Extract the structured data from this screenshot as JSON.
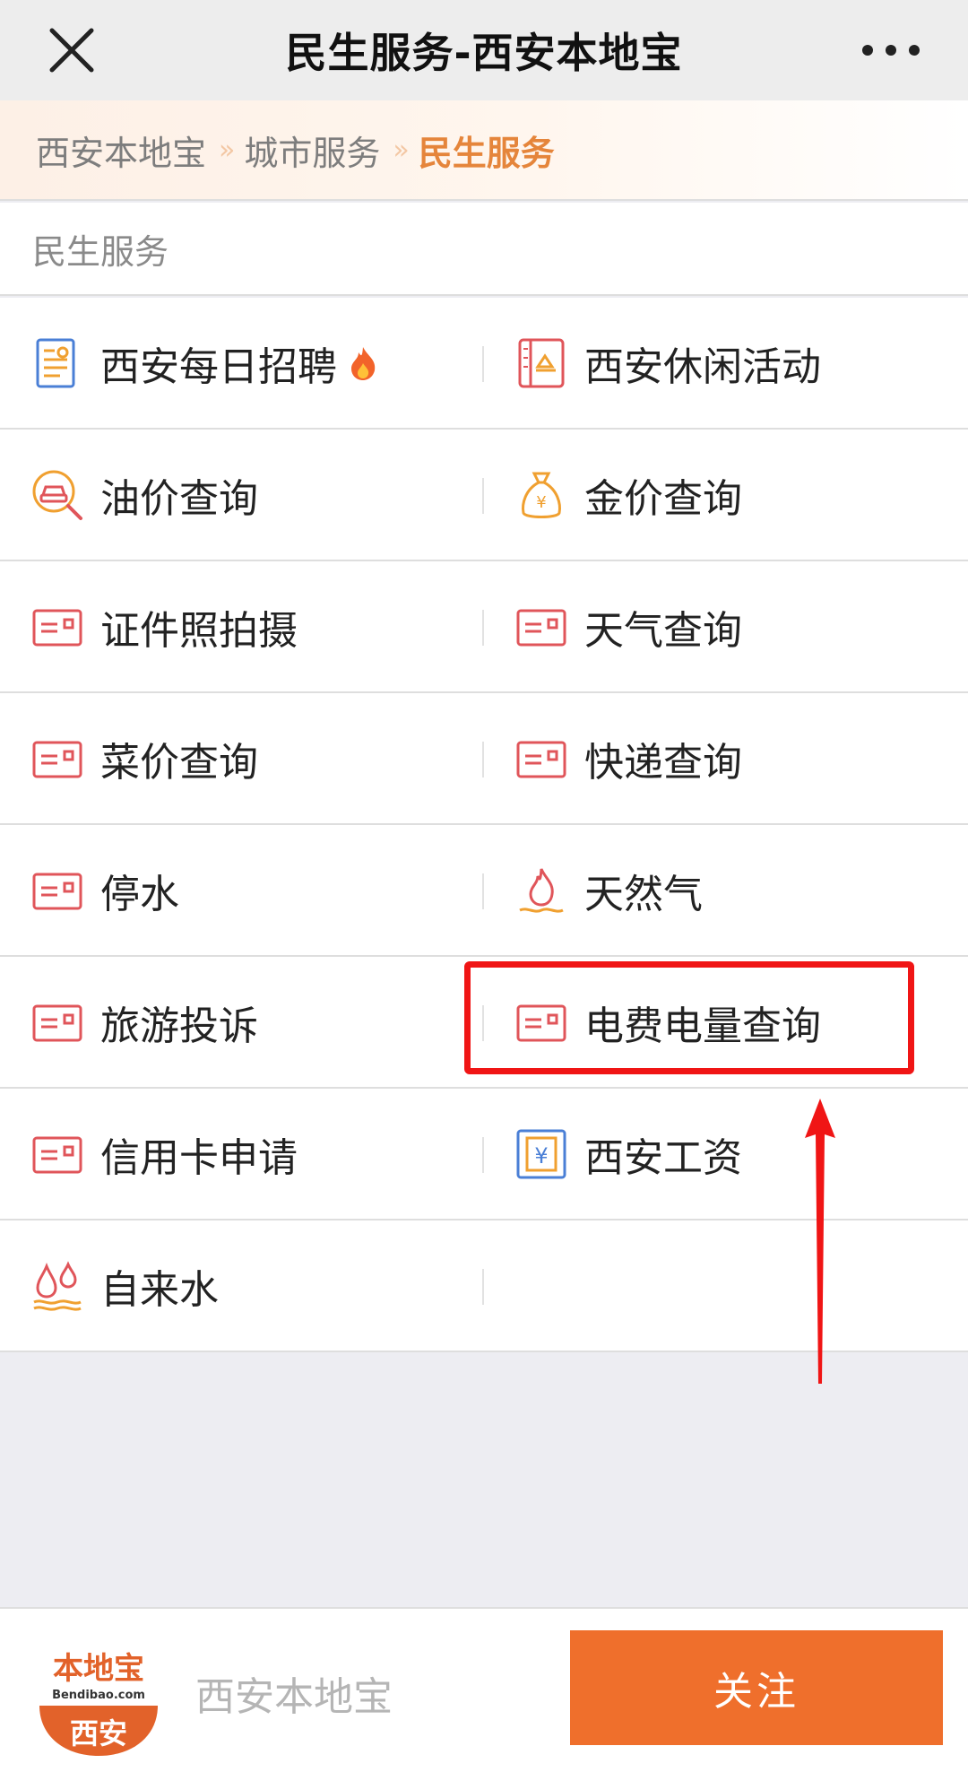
{
  "header": {
    "title": "民生服务-西安本地宝"
  },
  "breadcrumb": {
    "items": [
      "西安本地宝",
      "城市服务",
      "民生服务"
    ],
    "separator": "»"
  },
  "section": {
    "title": "民生服务"
  },
  "services": [
    [
      {
        "label": "西安每日招聘",
        "icon": "resume-icon",
        "hot": true
      },
      {
        "label": "西安休闲活动",
        "icon": "leisure-icon"
      }
    ],
    [
      {
        "label": "油价查询",
        "icon": "car-search-icon"
      },
      {
        "label": "金价查询",
        "icon": "money-bag-icon"
      }
    ],
    [
      {
        "label": "证件照拍摄",
        "icon": "card-icon"
      },
      {
        "label": "天气查询",
        "icon": "card-icon"
      }
    ],
    [
      {
        "label": "菜价查询",
        "icon": "card-icon"
      },
      {
        "label": "快递查询",
        "icon": "card-icon"
      }
    ],
    [
      {
        "label": "停水",
        "icon": "card-icon"
      },
      {
        "label": "天然气",
        "icon": "gas-flame-icon"
      }
    ],
    [
      {
        "label": "旅游投诉",
        "icon": "card-icon"
      },
      {
        "label": "电费电量查询",
        "icon": "card-icon",
        "highlighted": true
      }
    ],
    [
      {
        "label": "信用卡申请",
        "icon": "card-icon"
      },
      {
        "label": "西安工资",
        "icon": "yen-icon"
      }
    ],
    [
      {
        "label": "自来水",
        "icon": "water-drops-icon"
      },
      {
        "label": ""
      }
    ]
  ],
  "bottom_bar": {
    "logo": {
      "line1": "本地宝",
      "line2": "Bendibao.com",
      "line3": "西安"
    },
    "account_name": "西安本地宝",
    "follow_label": "关注"
  },
  "colors": {
    "accent": "#ef6f2c",
    "crumb_active": "#e5853b",
    "highlight": "#f01515",
    "icon_red": "#e0555a"
  }
}
